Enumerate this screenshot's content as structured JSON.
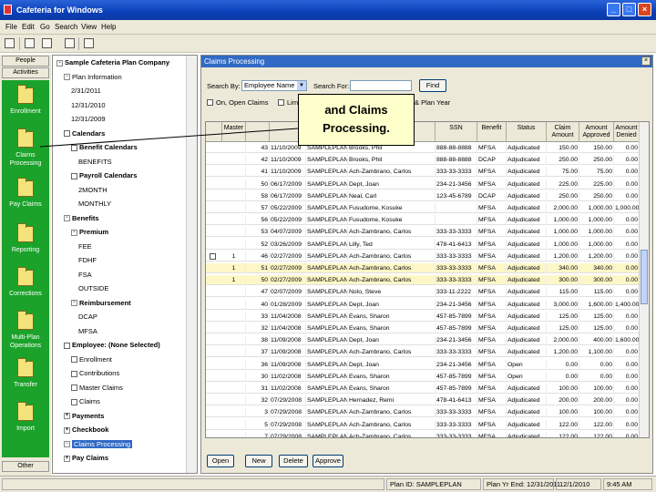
{
  "window": {
    "title": "Cafeteria for Windows"
  },
  "menu": [
    "File",
    "Edit",
    "Go",
    "Search",
    "View",
    "Help"
  ],
  "leftbar": {
    "top_buttons": [
      "People",
      "Activities"
    ],
    "items": [
      "Enrollment",
      "Claims Processing",
      "Pay Claims",
      "Reporting",
      "Corrections",
      "Multi-Plan Operations",
      "Transfer",
      "Import"
    ],
    "bottom_button": "Other"
  },
  "tree": [
    {
      "text": "Sample Cafeteria Plan Company",
      "level": 0,
      "bold": true,
      "exp": "-"
    },
    {
      "text": "Plan Information",
      "level": 1,
      "exp": "-"
    },
    {
      "text": "2/31/2011",
      "level": 2
    },
    {
      "text": "12/31/2010",
      "level": 2
    },
    {
      "text": "12/31/2009",
      "level": 2
    },
    {
      "text": "Calendars",
      "level": 1,
      "bold": true,
      "box": true
    },
    {
      "text": "Benefit Calendars",
      "level": 2,
      "bold": true,
      "box": true
    },
    {
      "text": "BENEFITS",
      "level": 3
    },
    {
      "text": "Payroll Calendars",
      "level": 2,
      "bold": true,
      "box": true
    },
    {
      "text": "2MONTH",
      "level": 3
    },
    {
      "text": "MONTHLY",
      "level": 3
    },
    {
      "text": "Benefits",
      "level": 1,
      "bold": true,
      "exp": "-"
    },
    {
      "text": "Premium",
      "level": 2,
      "bold": true,
      "exp": "-"
    },
    {
      "text": "FEE",
      "level": 3
    },
    {
      "text": "FDHF",
      "level": 3
    },
    {
      "text": "FSA",
      "level": 3
    },
    {
      "text": "OUTSIDE",
      "level": 3
    },
    {
      "text": "Reimbursement",
      "level": 2,
      "bold": true,
      "exp": "-"
    },
    {
      "text": "DCAP",
      "level": 3
    },
    {
      "text": "MFSA",
      "level": 3
    },
    {
      "text": "Employee: (None Selected)",
      "level": 1,
      "bold": true,
      "box": true
    },
    {
      "text": "Enrollment",
      "level": 2,
      "box": true
    },
    {
      "text": "Contributions",
      "level": 2,
      "box": true
    },
    {
      "text": "Master Claims",
      "level": 2,
      "box": true
    },
    {
      "text": "Claims",
      "level": 2,
      "box": true
    },
    {
      "text": "Payments",
      "level": 1,
      "bold": true,
      "exp": "+"
    },
    {
      "text": "Checkbook",
      "level": 1,
      "bold": true,
      "exp": "+"
    },
    {
      "text": "Claims Processing",
      "level": 1,
      "selected": true,
      "exp": "-"
    },
    {
      "text": "Pay Claims",
      "level": 1,
      "bold": true,
      "exp": "+"
    }
  ],
  "panel": {
    "title": "Claims Processing",
    "search_by_label": "Search By:",
    "search_by_value": "Employee Name",
    "search_for_label": "Search For:",
    "search_for_value": "",
    "find_label": "Find",
    "open_claims_label": "On, Open Claims",
    "lim_label": "Lim",
    "plan_year_label": "& Plan Year",
    "columns": [
      "Master",
      "",
      "",
      "",
      "SSN",
      "Benefit",
      "Status",
      "Claim Amount",
      "Amount Approved",
      "Amount Denied"
    ],
    "rows": [
      {
        "m": "",
        "no": "43",
        "date": "11/10/2009",
        "plan": "SAMPLEPLAN",
        "name": "Brooks, Phil",
        "ssn": "888-88-8888",
        "ben": "MFSA",
        "status": "Adjudicated",
        "claim": "150.00",
        "appr": "150.00",
        "den": "0.00"
      },
      {
        "m": "",
        "no": "42",
        "date": "11/10/2009",
        "plan": "SAMPLEPLAN",
        "name": "Brooks, Phil",
        "ssn": "888-88-8888",
        "ben": "DCAP",
        "status": "Adjudicated",
        "claim": "250.00",
        "appr": "250.00",
        "den": "0.00"
      },
      {
        "m": "",
        "no": "41",
        "date": "11/10/2009",
        "plan": "SAMPLEPLAN",
        "name": "Ach-Zambrano, Carlos",
        "ssn": "333-33-3333",
        "ben": "MFSA",
        "status": "Adjudicated",
        "claim": "75.00",
        "appr": "75.00",
        "den": "0.00"
      },
      {
        "m": "",
        "no": "50",
        "date": "06/17/2009",
        "plan": "SAMPLEPLAN",
        "name": "Dept, Joan",
        "ssn": "234-21-3456",
        "ben": "MFSA",
        "status": "Adjudicated",
        "claim": "225.00",
        "appr": "225.00",
        "den": "0.00"
      },
      {
        "m": "",
        "no": "58",
        "date": "06/17/2009",
        "plan": "SAMPLEPLAN",
        "name": "Neal, Carl",
        "ssn": "123-45-6789",
        "ben": "DCAP",
        "status": "Adjudicated",
        "claim": "250.00",
        "appr": "250.00",
        "den": "0.00"
      },
      {
        "m": "",
        "no": "57",
        "date": "05/22/2009",
        "plan": "SAMPLEPLAN",
        "name": "Fusudome, Kosuke",
        "ssn": "",
        "ben": "MFSA",
        "status": "Adjudicated",
        "claim": "2,000.00",
        "appr": "1,000.00",
        "den": "1,000.00"
      },
      {
        "m": "",
        "no": "56",
        "date": "05/22/2009",
        "plan": "SAMPLEPLAN",
        "name": "Fusudome, Kosuke",
        "ssn": "",
        "ben": "MFSA",
        "status": "Adjudicated",
        "claim": "1,000.00",
        "appr": "1,000.00",
        "den": "0.00"
      },
      {
        "m": "",
        "no": "53",
        "date": "04/07/2009",
        "plan": "SAMPLEPLAN",
        "name": "Ach-Zambrano, Carlos",
        "ssn": "333-33-3333",
        "ben": "MFSA",
        "status": "Adjudicated",
        "claim": "1,000.00",
        "appr": "1,000.00",
        "den": "0.00"
      },
      {
        "m": "",
        "no": "52",
        "date": "03/26/2009",
        "plan": "SAMPLEPLAN",
        "name": "Lilly, Ted",
        "ssn": "478-41-6413",
        "ben": "MFSA",
        "status": "Adjudicated",
        "claim": "1,000.00",
        "appr": "1,000.00",
        "den": "0.00"
      },
      {
        "m": "1",
        "no": "46",
        "date": "02/27/2009",
        "plan": "SAMPLEPLAN",
        "name": "Ach-Zambrano, Carlos",
        "ssn": "333-33-3333",
        "ben": "MFSA",
        "status": "Adjudicated",
        "claim": "1,200.00",
        "appr": "1,200.00",
        "den": "0.00",
        "box": true
      },
      {
        "m": "1",
        "no": "51",
        "date": "02/27/2009",
        "plan": "SAMPLEPLAN",
        "name": "Ach-Zambrano, Carlos",
        "ssn": "333-33-3333",
        "ben": "MFSA",
        "status": "Adjudicated",
        "claim": "340.00",
        "appr": "340.00",
        "den": "0.00",
        "hl": true
      },
      {
        "m": "1",
        "no": "50",
        "date": "02/27/2009",
        "plan": "SAMPLEPLAN",
        "name": "Ach-Zambrano, Carlos",
        "ssn": "333-33-3333",
        "ben": "MFSA",
        "status": "Adjudicated",
        "claim": "300.00",
        "appr": "300.00",
        "den": "0.00",
        "hl": true
      },
      {
        "m": "",
        "no": "47",
        "date": "02/07/2009",
        "plan": "SAMPLEPLAN",
        "name": "Nolo, Steve",
        "ssn": "333-11-2222",
        "ben": "MFSA",
        "status": "Adjudicated",
        "claim": "115.00",
        "appr": "115.00",
        "den": "0.00"
      },
      {
        "m": "",
        "no": "40",
        "date": "01/28/2009",
        "plan": "SAMPLEPLAN",
        "name": "Dept, Joan",
        "ssn": "234-21-3456",
        "ben": "MFSA",
        "status": "Adjudicated",
        "claim": "3,000.00",
        "appr": "1,600.00",
        "den": "1,400.00"
      },
      {
        "m": "",
        "no": "33",
        "date": "11/04/2008",
        "plan": "SAMPLEPLAN",
        "name": "Evans, Sharon",
        "ssn": "457-85-7899",
        "ben": "MFSA",
        "status": "Adjudicated",
        "claim": "125.00",
        "appr": "125.00",
        "den": "0.00"
      },
      {
        "m": "",
        "no": "32",
        "date": "11/04/2008",
        "plan": "SAMPLEPLAN",
        "name": "Evans, Sharon",
        "ssn": "457-85-7899",
        "ben": "MFSA",
        "status": "Adjudicated",
        "claim": "125.00",
        "appr": "125.00",
        "den": "0.00"
      },
      {
        "m": "",
        "no": "38",
        "date": "11/09/2008",
        "plan": "SAMPLEPLAN",
        "name": "Dept, Joan",
        "ssn": "234-21-3456",
        "ben": "MFSA",
        "status": "Adjudicated",
        "claim": "2,000.00",
        "appr": "400.00",
        "den": "1,600.00"
      },
      {
        "m": "",
        "no": "37",
        "date": "11/09/2008",
        "plan": "SAMPLEPLAN",
        "name": "Ach-Zambrano, Carlos",
        "ssn": "333-33-3333",
        "ben": "MFSA",
        "status": "Adjudicated",
        "claim": "1,200.00",
        "appr": "1,100.00",
        "den": "0.00"
      },
      {
        "m": "",
        "no": "36",
        "date": "11/09/2008",
        "plan": "SAMPLEPLAN",
        "name": "Dept, Joan",
        "ssn": "234-21-3456",
        "ben": "MFSA",
        "status": "Open",
        "claim": "0.00",
        "appr": "0.00",
        "den": "0.00"
      },
      {
        "m": "",
        "no": "30",
        "date": "11/02/2008",
        "plan": "SAMPLEPLAN",
        "name": "Evans, Sharon",
        "ssn": "457-85-7899",
        "ben": "MFSA",
        "status": "Open",
        "claim": "0.00",
        "appr": "0.00",
        "den": "0.00"
      },
      {
        "m": "",
        "no": "31",
        "date": "11/02/2008",
        "plan": "SAMPLEPLAN",
        "name": "Evans, Sharon",
        "ssn": "457-85-7899",
        "ben": "MFSA",
        "status": "Adjudicated",
        "claim": "100.00",
        "appr": "100.00",
        "den": "0.00"
      },
      {
        "m": "",
        "no": "32",
        "date": "07/29/2008",
        "plan": "SAMPLEPLAN",
        "name": "Hernadez, Remi",
        "ssn": "478-41-6413",
        "ben": "MFSA",
        "status": "Adjudicated",
        "claim": "200.00",
        "appr": "200.00",
        "den": "0.00"
      },
      {
        "m": "",
        "no": "3",
        "date": "07/29/2008",
        "plan": "SAMPLEPLAN",
        "name": "Ach-Zambrano, Carlos",
        "ssn": "333-33-3333",
        "ben": "MFSA",
        "status": "Adjudicated",
        "claim": "100.00",
        "appr": "100.00",
        "den": "0.00"
      },
      {
        "m": "",
        "no": "5",
        "date": "07/29/2008",
        "plan": "SAMPLEPLAN",
        "name": "Ach-Zambrano, Carlos",
        "ssn": "333-33-3333",
        "ben": "MFSA",
        "status": "Adjudicated",
        "claim": "122.00",
        "appr": "122.00",
        "den": "0.00"
      },
      {
        "m": "",
        "no": "7",
        "date": "07/29/2008",
        "plan": "SAMPLEPLAN",
        "name": "Ach-Zambrano, Carlos",
        "ssn": "333-33-3333",
        "ben": "MFSA",
        "status": "Adjudicated",
        "claim": "122.00",
        "appr": "122.00",
        "den": "0.00"
      }
    ],
    "buttons": [
      "Open",
      "New",
      "Delete",
      "Approve"
    ]
  },
  "status": {
    "plan_id": "Plan ID: SAMPLEPLAN",
    "plan_yr_end": "Plan Yr End: 12/31/2011",
    "date": "12/1/2010",
    "time": "9:45 AM"
  },
  "callout": {
    "line1": "and Claims",
    "line2": "Processing."
  },
  "colors": {
    "titlebar": "#0a3fb8",
    "outlook_green": "#1aa22a",
    "selection": "#316ac5",
    "highlight_row": "#fdf7c8",
    "callout": "#ffffcc"
  }
}
